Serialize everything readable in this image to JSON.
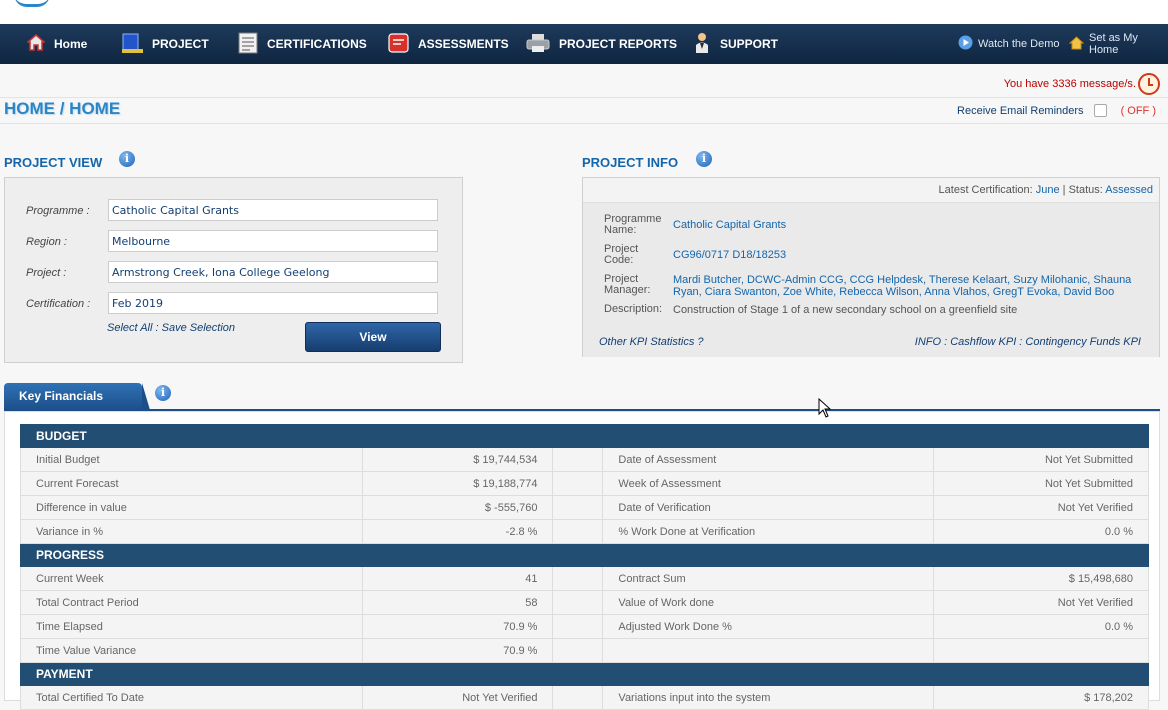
{
  "nav": {
    "home": "Home",
    "project": "PROJECT",
    "certifications": "CERTIFICATIONS",
    "assessments": "ASSESSMENTS",
    "project_reports": "PROJECT REPORTS",
    "support": "SUPPORT",
    "watch_demo": "Watch the Demo",
    "set_home": "Set as My Home"
  },
  "messages": {
    "text": "You have 3336 message/s."
  },
  "breadcrumb": "HOME / HOME",
  "reminders": {
    "label": "Receive Email Reminders",
    "state": "( OFF )"
  },
  "project_view": {
    "title": "PROJECT VIEW",
    "fields": [
      {
        "label": "Programme :",
        "value": "Catholic Capital Grants"
      },
      {
        "label": "Region :",
        "value": "Melbourne"
      },
      {
        "label": "Project :",
        "value": "Armstrong Creek, Iona College Geelong"
      },
      {
        "label": "Certification :",
        "value": "Feb 2019"
      }
    ],
    "select_all": "Select All",
    "separator": " : ",
    "save_selection": "Save Selection",
    "view_button": "View"
  },
  "project_info": {
    "title": "PROJECT INFO",
    "latest_label": "Latest Certification:",
    "latest_value": "June",
    "status_sep": "|",
    "status_label": "Status:",
    "status_value": "Assessed",
    "programme_label_1": "Programme",
    "programme_label_2": "Name:",
    "programme_value": "Catholic Capital Grants",
    "code_label_1": "Project",
    "code_label_2": "Code:",
    "code_value": "CG96/0717 D18/18253",
    "manager_label_1": "Project",
    "manager_label_2": "Manager:",
    "manager_line_1": "Mardi Butcher, DCWC-Admin CCG, CCG Helpdesk, Therese Kelaart, Suzy Milohanic, Shauna",
    "manager_line_2": "Ryan, Ciara Swanton, Zoe White, Rebecca Wilson, Anna Vlahos, GregT Evoka, David Boo",
    "description_label": "Description:",
    "description_value": "Construction of Stage 1 of a new secondary school on a greenfield site",
    "other_kpi": "Other KPI Statistics ?",
    "info_prefix": "INFO : ",
    "cashflow_kpi": "Cashflow KPI",
    "kpi_sep": " : ",
    "contingency_kpi": "Contingency Funds KPI"
  },
  "key_financials": {
    "tab_label": "Key Financials",
    "sections": [
      {
        "header": "BUDGET",
        "rows": [
          {
            "l_label": "Initial Budget",
            "l_value": "$ 19,744,534",
            "r_label": "Date of Assessment",
            "r_value": "Not Yet Submitted"
          },
          {
            "l_label": "Current Forecast",
            "l_value": "$ 19,188,774",
            "r_label": "Week of Assessment",
            "r_value": "Not Yet Submitted"
          },
          {
            "l_label": "Difference in value",
            "l_value": "$ -555,760",
            "r_label": "Date of Verification",
            "r_value": "Not Yet Verified"
          },
          {
            "l_label": "Variance in %",
            "l_value": "-2.8 %",
            "r_label": "% Work Done at Verification",
            "r_value": "0.0 %"
          }
        ]
      },
      {
        "header": "PROGRESS",
        "rows": [
          {
            "l_label": "Current Week",
            "l_value": "41",
            "r_label": "Contract Sum",
            "r_value": "$ 15,498,680"
          },
          {
            "l_label": "Total Contract Period",
            "l_value": "58",
            "r_label": "Value of Work done",
            "r_value": "Not Yet Verified"
          },
          {
            "l_label": "Time Elapsed",
            "l_value": "70.9 %",
            "r_label": "Adjusted Work Done %",
            "r_value": "0.0 %"
          },
          {
            "l_label": "Time Value Variance",
            "l_value": "70.9 %",
            "r_label": "",
            "r_value": ""
          }
        ]
      },
      {
        "header": "PAYMENT",
        "rows": [
          {
            "l_label": "Total Certified To Date",
            "l_value": "Not Yet Verified",
            "r_label": "Variations input into the system",
            "r_value": "$ 178,202"
          }
        ]
      }
    ]
  }
}
